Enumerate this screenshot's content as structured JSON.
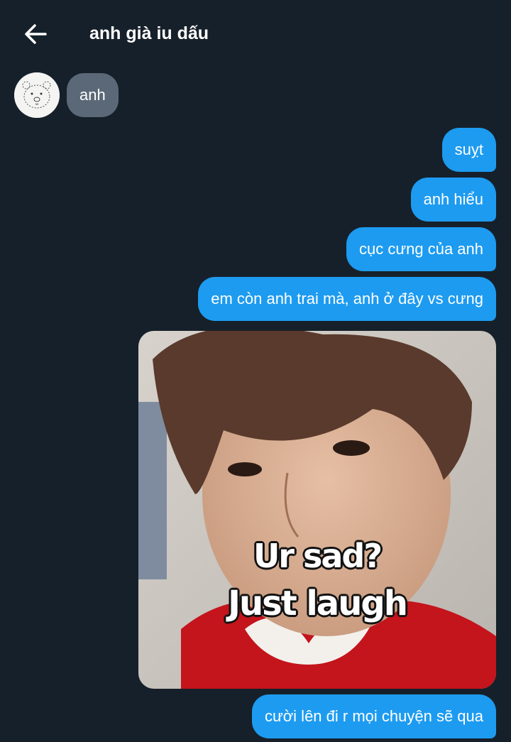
{
  "header": {
    "title": "anh già iu dấu",
    "back_icon": "arrow-left-icon"
  },
  "messages": {
    "incoming": [
      {
        "text": "anh"
      }
    ],
    "outgoing": [
      {
        "text": "suỵt"
      },
      {
        "text": "anh hiểu"
      },
      {
        "text": "cục cưng của anh"
      },
      {
        "text": "em còn anh trai mà, anh ở đây vs cưng"
      },
      {
        "text": "cười lên đi r mọi chuyện sẽ qua"
      }
    ]
  },
  "photo": {
    "caption_line1": "Ur sad?",
    "caption_line2": "Just laugh"
  },
  "colors": {
    "background": "#16202a",
    "outgoing_bubble": "#1d9bf0",
    "incoming_bubble": "#5b6877"
  }
}
